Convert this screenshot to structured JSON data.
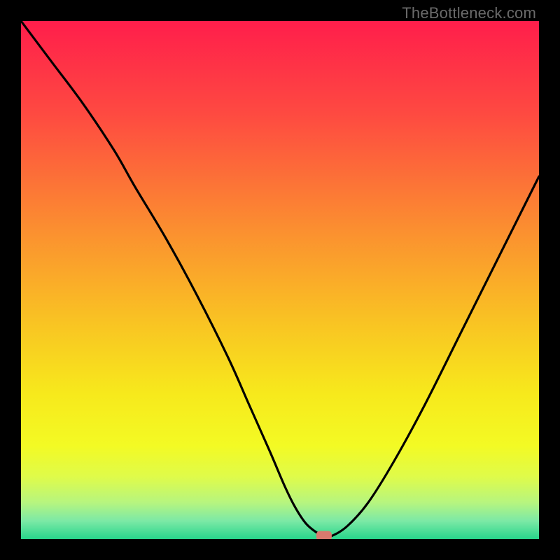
{
  "watermark": {
    "text": "TheBottleneck.com"
  },
  "chart_data": {
    "type": "line",
    "title": "",
    "xlabel": "",
    "ylabel": "",
    "xlim": [
      0,
      100
    ],
    "ylim": [
      0,
      100
    ],
    "grid": false,
    "series": [
      {
        "name": "curve",
        "x": [
          0,
          6,
          12,
          18,
          22,
          28,
          34,
          40,
          44,
          48,
          51,
          53,
          55,
          57,
          58.5,
          60,
          63,
          67,
          72,
          78,
          85,
          92,
          100
        ],
        "y": [
          100,
          92,
          84,
          75,
          68,
          58,
          47,
          35,
          26,
          17,
          10,
          6,
          3,
          1.3,
          0.6,
          0.6,
          2.5,
          7,
          15,
          26,
          40,
          54,
          70
        ]
      }
    ],
    "marker": {
      "x": 58.5,
      "y": 0.6,
      "color": "#D9796E"
    },
    "gradient_stops": [
      {
        "pct": 0,
        "color": "#FF1E4B"
      },
      {
        "pct": 18,
        "color": "#FE4A41"
      },
      {
        "pct": 40,
        "color": "#FB8E30"
      },
      {
        "pct": 58,
        "color": "#F9C323"
      },
      {
        "pct": 72,
        "color": "#F7E91C"
      },
      {
        "pct": 82,
        "color": "#F3FA24"
      },
      {
        "pct": 88,
        "color": "#DFFB4A"
      },
      {
        "pct": 93,
        "color": "#B6F57F"
      },
      {
        "pct": 96.5,
        "color": "#7CE9A6"
      },
      {
        "pct": 100,
        "color": "#28D58B"
      }
    ]
  }
}
